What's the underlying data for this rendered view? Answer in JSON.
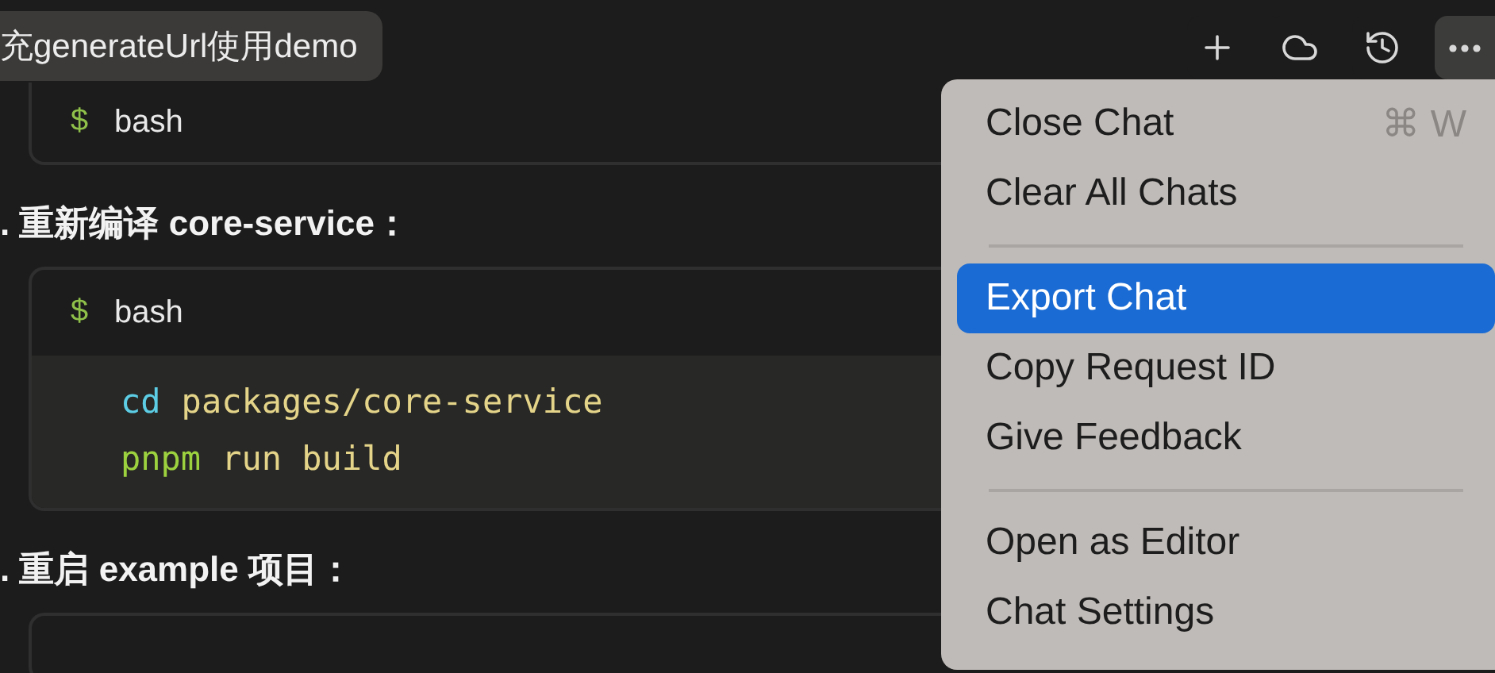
{
  "title_chip": "充generateUrl使用demo",
  "toolbar": [
    {
      "kind": "plus",
      "selected": false
    },
    {
      "kind": "cloud",
      "selected": false
    },
    {
      "kind": "history",
      "selected": false
    },
    {
      "kind": "more",
      "selected": true
    }
  ],
  "content": [
    {
      "kind": "code",
      "prompt": "$",
      "language": "bash"
    },
    {
      "kind": "heading",
      "text": ". 重新编译 core-service："
    },
    {
      "kind": "code",
      "prompt": "$",
      "language": "bash",
      "lines": [
        [
          {
            "text": "cd",
            "color": "#5ccde4"
          },
          {
            "text": "packages/core-service",
            "color": "#e4d489"
          }
        ],
        [
          {
            "text": "pnpm",
            "color": "#9dd23f"
          },
          {
            "text": "run build",
            "color": "#e4d489"
          }
        ]
      ]
    },
    {
      "kind": "heading",
      "text": ". 重启 example 项目："
    },
    {
      "kind": "code"
    }
  ],
  "menu": [
    {
      "kind": "item",
      "label": "Close Chat",
      "shortcut": "⌘ W",
      "selected": false
    },
    {
      "kind": "item",
      "label": "Clear All Chats",
      "selected": false
    },
    {
      "kind": "separator"
    },
    {
      "kind": "item",
      "label": "Export Chat",
      "selected": true
    },
    {
      "kind": "item",
      "label": "Copy Request ID",
      "selected": false
    },
    {
      "kind": "item",
      "label": "Give Feedback",
      "selected": false
    },
    {
      "kind": "separator"
    },
    {
      "kind": "item",
      "label": "Open as Editor",
      "selected": false
    },
    {
      "kind": "item",
      "label": "Chat Settings",
      "selected": false
    }
  ]
}
